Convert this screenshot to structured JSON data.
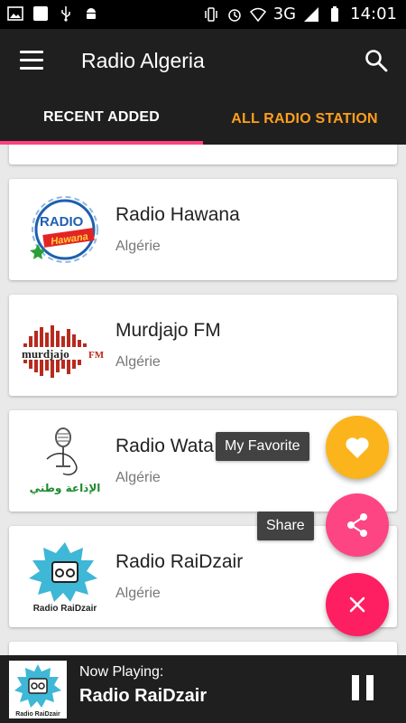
{
  "statusbar": {
    "network": "3G",
    "time": "14:01"
  },
  "appbar": {
    "title": "Radio Algeria"
  },
  "tabs": [
    {
      "label": "RECENT ADDED"
    },
    {
      "label": "ALL RADIO STATION"
    }
  ],
  "stations": [
    {
      "name": "Radio Hawana",
      "country": "Algérie",
      "logo_text": [
        "RADIO",
        "Hawana"
      ]
    },
    {
      "name": "Murdjajo FM",
      "country": "Algérie",
      "logo_text": [
        "murdjajo",
        "FM"
      ]
    },
    {
      "name": "Radio Wata",
      "country": "Algérie",
      "logo_text": [
        "الإذاعة وطني"
      ]
    },
    {
      "name": "Radio RaiDzair",
      "country": "Algérie",
      "logo_text": [
        "Radio RaiDzair"
      ]
    }
  ],
  "fab": {
    "favorite_label": "My Favorite",
    "share_label": "Share"
  },
  "player": {
    "now_playing_label": "Now Playing:",
    "station": "Radio RaiDzair",
    "thumb_text": "Radio RaiDzair"
  },
  "colors": {
    "toolbar": "#1f1f1f",
    "tab_indicator": "#ff4081",
    "tab_inactive": "#ff9f1c",
    "fab_favorite": "#fbb41c",
    "fab_share": "#fd4584",
    "fab_close": "#fe1e62"
  }
}
